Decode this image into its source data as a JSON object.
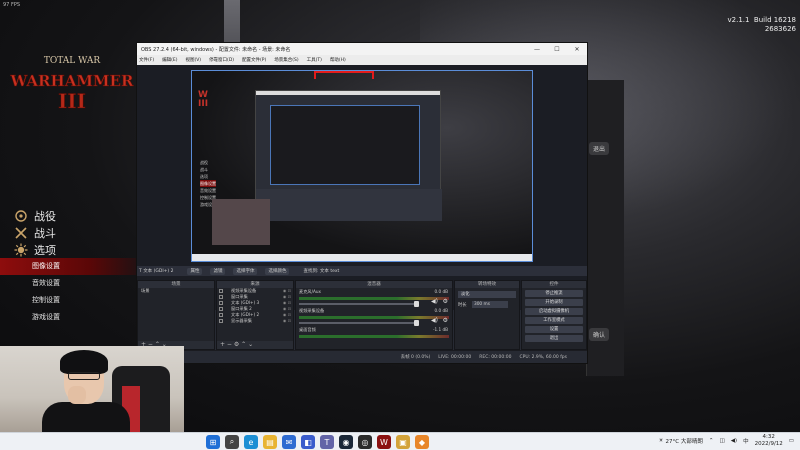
{
  "game": {
    "fps_text": "97 FPS",
    "build_text": "v2.1.1  Build 16218\n2683626",
    "logo_line1": "TOTAL WAR",
    "logo_line2": "WARHAMMER",
    "logo_numeral": "III",
    "menu": [
      {
        "label": "战役",
        "icon": "campaign-emblem-icon"
      },
      {
        "label": "战斗",
        "icon": "battle-emblem-icon"
      },
      {
        "label": "选项",
        "icon": "options-emblem-icon"
      }
    ],
    "submenu": [
      {
        "label": "图像设置",
        "active": true
      },
      {
        "label": "音效设置",
        "active": false
      },
      {
        "label": "控制设置",
        "active": false
      },
      {
        "label": "游戏设置",
        "active": false
      }
    ],
    "side_button_1": "退出",
    "side_button_2": "确认"
  },
  "obs": {
    "title": "OBS 27.2.4 (64-bit, windows) - 配置文件: 未命名 - 场景: 未命名",
    "menus": [
      "文件(F)",
      "编辑(E)",
      "视图(V)",
      "停靠窗口(D)",
      "配置文件(P)",
      "场景集合(S)",
      "工具(T)",
      "帮助(H)"
    ],
    "source_toolbar": {
      "item": "文本 (GDI+) 2",
      "properties": "属性",
      "filters": "滤镜",
      "select_font": "选择字体",
      "select_color": "选择颜色",
      "text_label": "查找到: 文本 text"
    },
    "docks": {
      "scenes": {
        "title": "场景",
        "items": [
          "场景"
        ]
      },
      "sources": {
        "title": "来源",
        "items": [
          "视频采集设备",
          "窗口采集",
          "文本 (GDI+) 3",
          "窗口采集 2",
          "文本 (GDI+) 2",
          "显示器采集"
        ]
      },
      "mixer": {
        "title": "混音器",
        "channels": [
          {
            "name": "麦克风/Aux",
            "db": "0.0 dB"
          },
          {
            "name": "视频采集设备",
            "db": "0.0 dB"
          },
          {
            "name": "桌面音频",
            "db": "-1.1 dB"
          }
        ]
      },
      "transitions": {
        "title": "转场特效",
        "selected": "淡化",
        "duration_label": "时长",
        "duration_value": "300 ms"
      },
      "controls": {
        "title": "控件",
        "buttons": [
          "停止推流",
          "开始录制",
          "启动虚拟摄像机",
          "工作室模式",
          "设置",
          "退出"
        ]
      }
    },
    "status": {
      "dropped": "丢帧 0 (0.0%)",
      "live": "LIVE: 00:00:00",
      "rec": "REC: 00:00:00",
      "cpu": "CPU: 2.9%, 60.00 fps"
    },
    "preview_menu": [
      "战役",
      "战斗",
      "选项",
      "图像设置",
      "音效设置",
      "控制设置",
      "游戏设置"
    ]
  },
  "taskbar": {
    "apps": [
      {
        "icon": "start-windows-icon",
        "color": "#1f6fd6"
      },
      {
        "icon": "search-icon",
        "color": "#444444"
      },
      {
        "icon": "edge-browser-icon",
        "color": "#1c8fd4"
      },
      {
        "icon": "file-explorer-icon",
        "color": "#e8b433"
      },
      {
        "icon": "mail-icon",
        "color": "#2e6bd1"
      },
      {
        "icon": "store-icon",
        "color": "#3a5ccc"
      },
      {
        "icon": "teams-icon",
        "color": "#6264a7"
      },
      {
        "icon": "steam-icon",
        "color": "#1b2838"
      },
      {
        "icon": "obs-icon",
        "color": "#2b2b2b"
      },
      {
        "icon": "game-launcher-icon",
        "color": "#8b1111"
      },
      {
        "icon": "folder-icon",
        "color": "#d3a33a"
      },
      {
        "icon": "app-icon",
        "color": "#e8862a"
      }
    ],
    "weather": "27°C 大部晴朗",
    "time": "4:32",
    "date": "2022/9/12"
  }
}
